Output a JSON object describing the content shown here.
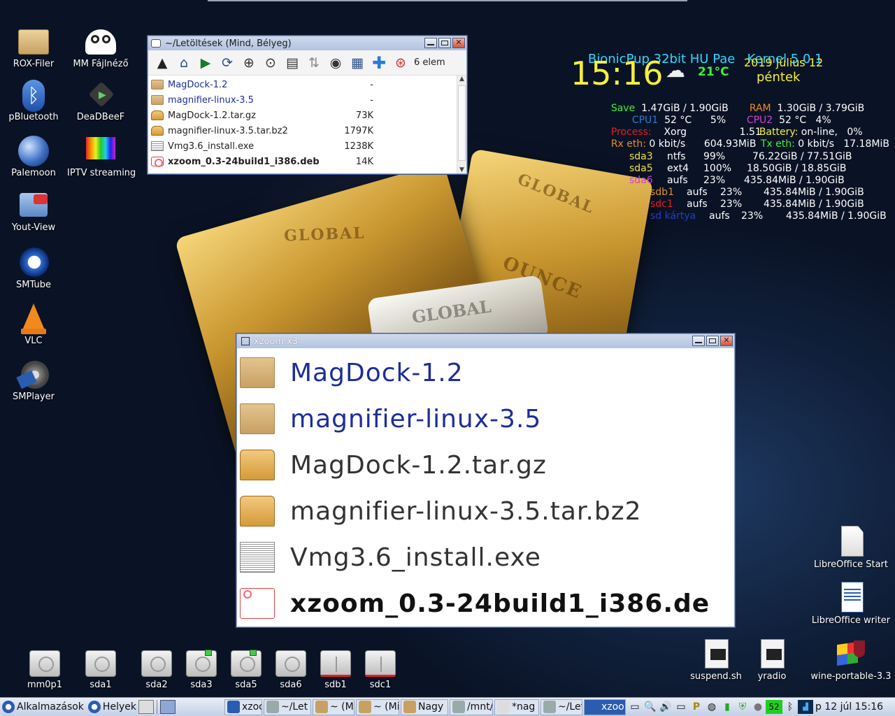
{
  "desktop_icons": {
    "rox_filer": "ROX-Filer",
    "mm_fajlnezo": "MM Fájlnéző",
    "pbluetooth": "pBluetooth",
    "deadbeef": "DeaDBeeF",
    "palemoon": "Palemoon",
    "iptv": "IPTV streaming",
    "youtview": "Yout-View",
    "smtube": "SMTube",
    "vlc": "VLC",
    "smplayer": "SMPlayer",
    "lo_start": "LibreOffice Start",
    "lo_writer": "LibreOffice writer",
    "suspend": "suspend.sh",
    "yradio": "yradio",
    "wine": "wine-portable-3.3"
  },
  "drives": [
    "mm0p1",
    "sda1",
    "sda2",
    "sda3",
    "sda5",
    "sda6",
    "sdb1",
    "sdc1"
  ],
  "rox_window": {
    "title": "~/Letöltések (Mind, Bélyeg)",
    "count": "6 elem",
    "files": [
      {
        "name": "MagDock-1.2",
        "size": "-",
        "type": "dir"
      },
      {
        "name": "magnifier-linux-3.5",
        "size": "-",
        "type": "dir"
      },
      {
        "name": "MagDock-1.2.tar.gz",
        "size": "73K",
        "type": "pkg"
      },
      {
        "name": "magnifier-linux-3.5.tar.bz2",
        "size": "1797K",
        "type": "pkg"
      },
      {
        "name": "Vmg3.6_install.exe",
        "size": "1238K",
        "type": "exe"
      },
      {
        "name": "xzoom_0.3-24build1_i386.deb",
        "size": "14K",
        "type": "deb"
      }
    ]
  },
  "xzoom_window": {
    "title": "xzoom x3",
    "rows": [
      "MagDock-1.2",
      "magnifier-linux-3.5",
      "MagDock-1.2.tar.gz",
      "magnifier-linux-3.5.tar.bz2",
      "Vmg3.6_install.exe",
      "xzoom_0.3-24build1_i386.de"
    ]
  },
  "conky": {
    "distro": "BionicPup 32bit HU Pae",
    "kernel": "Kernel 5.0.1",
    "time": "15:16",
    "temp": "21°C",
    "date": "2019 július 12",
    "weekday": "péntek",
    "save_label": "Save",
    "save_val": "1.47GiB / 1.90GiB",
    "ram_label": "RAM",
    "ram_val": "1.30GiB / 3.79GiB",
    "cpu1_label": "CPU1",
    "cpu1_val": "52 °C      5%",
    "cpu2_label": "CPU2",
    "cpu2_val": "52 °C   4%",
    "process_label": "Process:",
    "process_val": "Xorg                 1.51",
    "battery_label": "Battery:",
    "battery_val": "on-line,   0%",
    "rx_label": "Rx eth:",
    "rx_val": "0 kbit/s      604.93MiB",
    "tx_label": "Tx eth:",
    "tx_val": "0 kbit/s   17.18MiB",
    "disks": [
      {
        "dev": "sda3",
        "fs": "ntfs",
        "pct": "99%",
        "size": "76.22GiB / 77.51GiB",
        "color": "#f0e040"
      },
      {
        "dev": "sda5",
        "fs": "ext4",
        "pct": "100%",
        "size": "18.50GiB / 18.85GiB",
        "color": "#f0e040"
      },
      {
        "dev": "sda6",
        "fs": "aufs",
        "pct": "23%",
        "size": "435.84MiB / 1.90GiB",
        "color": "#d040d0"
      },
      {
        "dev": "sdb1",
        "fs": "aufs",
        "pct": "23%",
        "size": "435.84MiB / 1.90GiB",
        "color": "#e09020"
      },
      {
        "dev": "sdc1",
        "fs": "aufs",
        "pct": "23%",
        "size": "435.84MiB / 1.90GiB",
        "color": "#e02020"
      },
      {
        "dev": "sd kártya",
        "fs": "aufs",
        "pct": "23%",
        "size": "435.84MiB / 1.90GiB",
        "color": "#2040c0"
      }
    ]
  },
  "taskbar": {
    "menu": "Alkalmazások",
    "places": "Helyek",
    "tasks": [
      "xzoo",
      "~/Let",
      "~ (Mi",
      "~ (Mi",
      "Nagy",
      "/mnt/",
      "*nag",
      "~/Let",
      "xzoo"
    ],
    "cpu_temp": "52",
    "clock": "p 12 júl 15:16"
  },
  "colors": {
    "accent_blue": "#2a5db0",
    "conky_cyan": "#2fd6ff",
    "conky_yellow": "#f5ef3c",
    "conky_green": "#3cf03c",
    "conky_red": "#e02020"
  }
}
